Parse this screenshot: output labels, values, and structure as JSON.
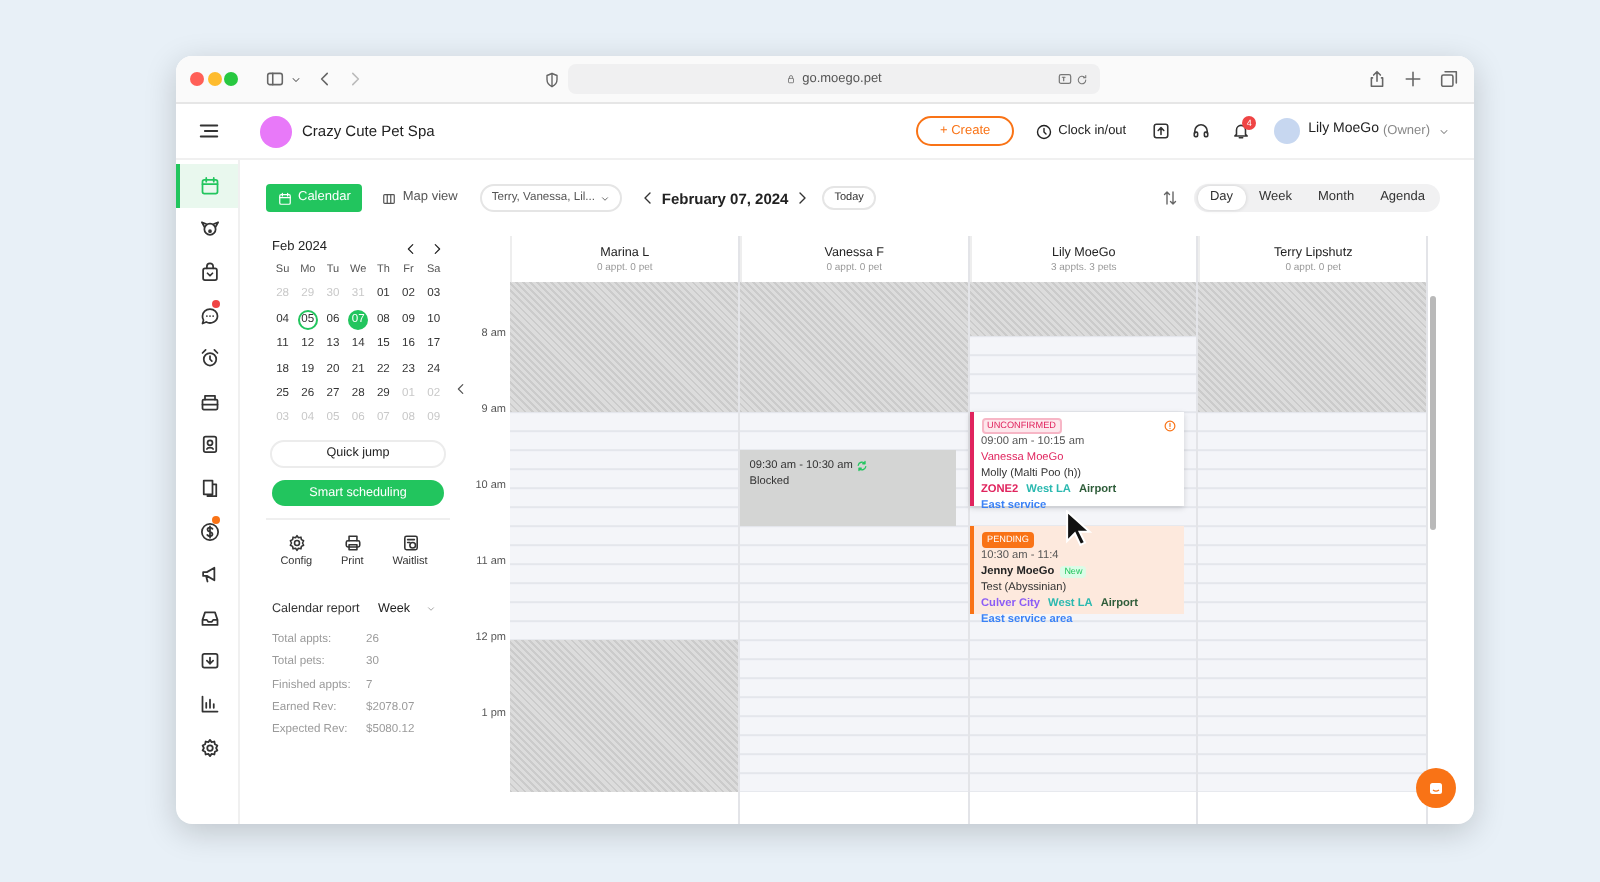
{
  "browser": {
    "url": "go.moego.pet"
  },
  "header": {
    "business": "Crazy Cute Pet Spa",
    "create": "+ Create",
    "clock": "Clock in/out",
    "notifications": "4",
    "user": "Lily MoeGo",
    "role": "(Owner)"
  },
  "rail": [
    {
      "selected": true
    },
    {
      "selected": false
    },
    {
      "selected": false
    },
    {
      "selected": false,
      "color": "#ef4444"
    },
    {
      "selected": false
    },
    {
      "selected": false
    },
    {
      "selected": false
    },
    {
      "selected": false
    },
    {
      "selected": false,
      "color": "#f97316"
    },
    {
      "selected": false
    },
    {
      "selected": false
    },
    {
      "selected": false
    },
    {
      "selected": false
    },
    {
      "selected": false
    }
  ],
  "view_tabs": [
    {
      "label": "Calendar",
      "selected": true
    },
    {
      "label": "Map view",
      "selected": false
    }
  ],
  "staff_filter": "Terry, Vanessa, Lil...",
  "date": "February 07, 2024",
  "today_button": "Today",
  "range_tabs": [
    {
      "label": "Day",
      "selected": true
    },
    {
      "label": "Week",
      "selected": false
    },
    {
      "label": "Month",
      "selected": false
    },
    {
      "label": "Agenda",
      "selected": false
    }
  ],
  "mini_calendar": {
    "month": "Feb 2024",
    "weekdays": [
      "Su",
      "Mo",
      "Tu",
      "We",
      "Th",
      "Fr",
      "Sa"
    ],
    "days": [
      {
        "day": "28",
        "muted": true,
        "today": false,
        "selected": false
      },
      {
        "day": "29",
        "muted": true,
        "today": false,
        "selected": false
      },
      {
        "day": "30",
        "muted": true,
        "today": false,
        "selected": false
      },
      {
        "day": "31",
        "muted": true,
        "today": false,
        "selected": false
      },
      {
        "day": "01",
        "muted": false,
        "today": false,
        "selected": false
      },
      {
        "day": "02",
        "muted": false,
        "today": false,
        "selected": false
      },
      {
        "day": "03",
        "muted": false,
        "today": false,
        "selected": false
      },
      {
        "day": "04",
        "muted": false,
        "today": false,
        "selected": false
      },
      {
        "day": "05",
        "muted": false,
        "today": true,
        "selected": false
      },
      {
        "day": "06",
        "muted": false,
        "today": false,
        "selected": false
      },
      {
        "day": "07",
        "muted": false,
        "today": false,
        "selected": true
      },
      {
        "day": "08",
        "muted": false,
        "today": false,
        "selected": false
      },
      {
        "day": "09",
        "muted": false,
        "today": false,
        "selected": false
      },
      {
        "day": "10",
        "muted": false,
        "today": false,
        "selected": false
      },
      {
        "day": "11",
        "muted": false,
        "today": false,
        "selected": false
      },
      {
        "day": "12",
        "muted": false,
        "today": false,
        "selected": false
      },
      {
        "day": "13",
        "muted": false,
        "today": false,
        "selected": false
      },
      {
        "day": "14",
        "muted": false,
        "today": false,
        "selected": false
      },
      {
        "day": "15",
        "muted": false,
        "today": false,
        "selected": false
      },
      {
        "day": "16",
        "muted": false,
        "today": false,
        "selected": false
      },
      {
        "day": "17",
        "muted": false,
        "today": false,
        "selected": false
      },
      {
        "day": "18",
        "muted": false,
        "today": false,
        "selected": false
      },
      {
        "day": "19",
        "muted": false,
        "today": false,
        "selected": false
      },
      {
        "day": "20",
        "muted": false,
        "today": false,
        "selected": false
      },
      {
        "day": "21",
        "muted": false,
        "today": false,
        "selected": false
      },
      {
        "day": "22",
        "muted": false,
        "today": false,
        "selected": false
      },
      {
        "day": "23",
        "muted": false,
        "today": false,
        "selected": false
      },
      {
        "day": "24",
        "muted": false,
        "today": false,
        "selected": false
      },
      {
        "day": "25",
        "muted": false,
        "today": false,
        "selected": false
      },
      {
        "day": "26",
        "muted": false,
        "today": false,
        "selected": false
      },
      {
        "day": "27",
        "muted": false,
        "today": false,
        "selected": false
      },
      {
        "day": "28",
        "muted": false,
        "today": false,
        "selected": false
      },
      {
        "day": "29",
        "muted": false,
        "today": false,
        "selected": false
      },
      {
        "day": "01",
        "muted": true,
        "today": false,
        "selected": false
      },
      {
        "day": "02",
        "muted": true,
        "today": false,
        "selected": false
      },
      {
        "day": "03",
        "muted": true,
        "today": false,
        "selected": false
      },
      {
        "day": "04",
        "muted": true,
        "today": false,
        "selected": false
      },
      {
        "day": "05",
        "muted": true,
        "today": false,
        "selected": false
      },
      {
        "day": "06",
        "muted": true,
        "today": false,
        "selected": false
      },
      {
        "day": "07",
        "muted": true,
        "today": false,
        "selected": false
      },
      {
        "day": "08",
        "muted": true,
        "today": false,
        "selected": false
      },
      {
        "day": "09",
        "muted": true,
        "today": false,
        "selected": false
      }
    ]
  },
  "quick_jump": "Quick jump",
  "smart_scheduling": "Smart scheduling",
  "tools": [
    {
      "label": "Config"
    },
    {
      "label": "Print"
    },
    {
      "label": "Waitlist"
    }
  ],
  "report": {
    "title": "Calendar report",
    "period": "Week",
    "stats": [
      {
        "label": "Total appts:",
        "value": "26"
      },
      {
        "label": "Total pets:",
        "value": "30"
      },
      {
        "label": "Finished appts:",
        "value": "7"
      },
      {
        "label": "Earned Rev:",
        "value": "$2078.07"
      },
      {
        "label": "Expected Rev:",
        "value": "$5080.12"
      }
    ]
  },
  "time_labels": [
    "8 am",
    "9 am",
    "10 am",
    "11 am",
    "12 pm",
    "1 pm"
  ],
  "staff": [
    {
      "name": "Marina L",
      "summary": "0 appt. 0 pet"
    },
    {
      "name": "Vanessa F",
      "summary": "0 appt. 0 pet",
      "events": [
        {
          "kind": "blocked",
          "time": "09:30 am - 10:30 am",
          "repeat": true,
          "label": "Blocked"
        }
      ]
    },
    {
      "name": "Lily MoeGo",
      "summary": "3 appts. 3 pets",
      "events": [
        {
          "kind": "unconfirmed",
          "status": "UNCONFIRMED",
          "alert": true,
          "time": "09:00 am - 10:15 am",
          "client": "Vanessa MoeGo",
          "pet": "Molly (Malti Poo (h))",
          "tags": [
            {
              "label": "ZONE2",
              "color": "#e0245e"
            },
            {
              "label": "West LA",
              "color": "#2bb9b0"
            },
            {
              "label": "Airport",
              "color": "#2f5d3a"
            },
            {
              "label": "East service",
              "color": "#3b82f6"
            }
          ]
        },
        {
          "kind": "pending",
          "status": "PENDING",
          "alert": false,
          "time": "10:30 am - 11:4",
          "client": "Jenny MoeGo",
          "client_badge": "New",
          "pet": "Test (Abyssinian)",
          "tags": [
            {
              "label": "Culver City",
              "color": "#8b5cf6"
            },
            {
              "label": "West LA",
              "color": "#2bb9b0"
            },
            {
              "label": "Airport",
              "color": "#2f5d3a"
            },
            {
              "label": "East service area",
              "color": "#3b82f6"
            }
          ]
        }
      ]
    },
    {
      "name": "Terry Lipshutz",
      "summary": "0 appt. 0 pet"
    }
  ]
}
